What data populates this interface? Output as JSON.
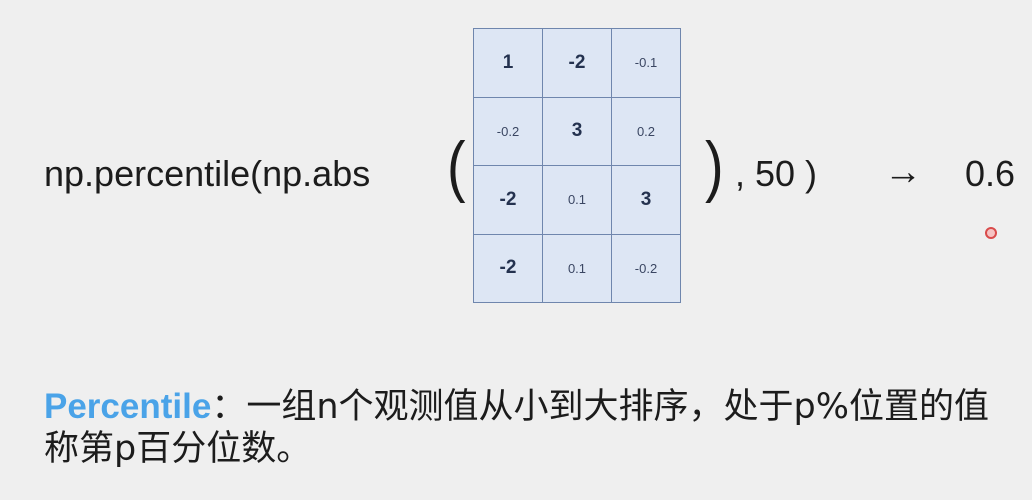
{
  "expression": {
    "function_call": "np.percentile(np.abs",
    "open_paren": "(",
    "close_paren": ")",
    "tail": ", 50 )",
    "arrow": "→",
    "result": "0.6"
  },
  "matrix": {
    "rows": [
      [
        {
          "value": "1",
          "emphasis": true
        },
        {
          "value": "-2",
          "emphasis": true
        },
        {
          "value": "-0.1",
          "emphasis": false
        }
      ],
      [
        {
          "value": "-0.2",
          "emphasis": false
        },
        {
          "value": "3",
          "emphasis": true
        },
        {
          "value": "0.2",
          "emphasis": false
        }
      ],
      [
        {
          "value": "-2",
          "emphasis": true
        },
        {
          "value": "0.1",
          "emphasis": false
        },
        {
          "value": "3",
          "emphasis": true
        }
      ],
      [
        {
          "value": "-2",
          "emphasis": true
        },
        {
          "value": "0.1",
          "emphasis": false
        },
        {
          "value": "-0.2",
          "emphasis": false
        }
      ]
    ]
  },
  "definition": {
    "term": "Percentile",
    "separator": "：",
    "body": "一组n个观测值从小到大排序，处于p%位置的值称第p百分位数。"
  },
  "colors": {
    "term_accent": "#4aa3e8",
    "matrix_fill": "#dde6f4",
    "matrix_border": "#6f86ad",
    "cursor_dot": "#d94b4b"
  }
}
